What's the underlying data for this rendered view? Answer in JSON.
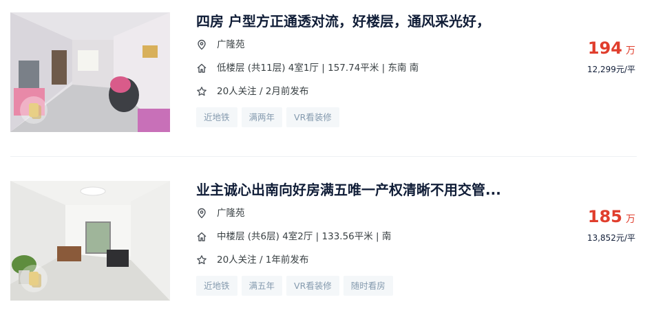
{
  "listings": [
    {
      "title": "四房 户型方正通透对流，好楼层，通风采光好，",
      "community": "广隆苑",
      "house_info": "低楼层 (共11层) 4室1厅 | 157.74平米 | 东南 南",
      "follow_info": "20人关注 / 2月前发布",
      "tags": [
        "近地铁",
        "满两年",
        "VR看装修"
      ],
      "total_price": "194",
      "total_unit": "万",
      "unit_price": "12,299元/平"
    },
    {
      "title": "业主诚心出南向好房满五唯一产权清晰不用交管...",
      "community": "广隆苑",
      "house_info": "中楼层 (共6层) 4室2厅 | 133.56平米 | 南",
      "follow_info": "20人关注 / 1年前发布",
      "tags": [
        "近地铁",
        "满五年",
        "VR看装修",
        "随时看房"
      ],
      "total_price": "185",
      "total_unit": "万",
      "unit_price": "13,852元/平"
    }
  ],
  "icons": {
    "location": "location-pin-icon",
    "house": "house-icon",
    "follow": "star-icon",
    "vr": "vr-badge-icon"
  },
  "colors": {
    "price": "#e03e2d",
    "title": "#101d37",
    "tag_text": "#849aae",
    "tag_bg": "#f4f7f9"
  }
}
